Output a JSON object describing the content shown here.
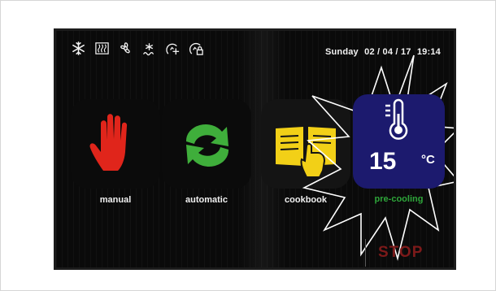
{
  "status_bar": {
    "icons": [
      "snowflake-icon",
      "heater-icon",
      "fan-icon",
      "defrost-icon",
      "add-program-icon",
      "lock-program-icon"
    ],
    "day": "Sunday",
    "date": "02 / 04 / 17",
    "time": "19:14"
  },
  "menu": {
    "manual": {
      "label": "manual",
      "icon": "hand-icon",
      "color": "#e0251b"
    },
    "automatic": {
      "label": "automatic",
      "icon": "recycle-arrows-icon",
      "color": "#3fae3b"
    },
    "cookbook": {
      "label": "cookbook",
      "icon": "book-icon",
      "color": "#f2d017"
    }
  },
  "precooling": {
    "label": "pre-cooling",
    "icon": "thermometer-icon",
    "temperature": "15",
    "unit": "°C",
    "tile_color": "#1c1a6e",
    "label_color": "#2ea63a"
  },
  "stop_label": "STOP"
}
